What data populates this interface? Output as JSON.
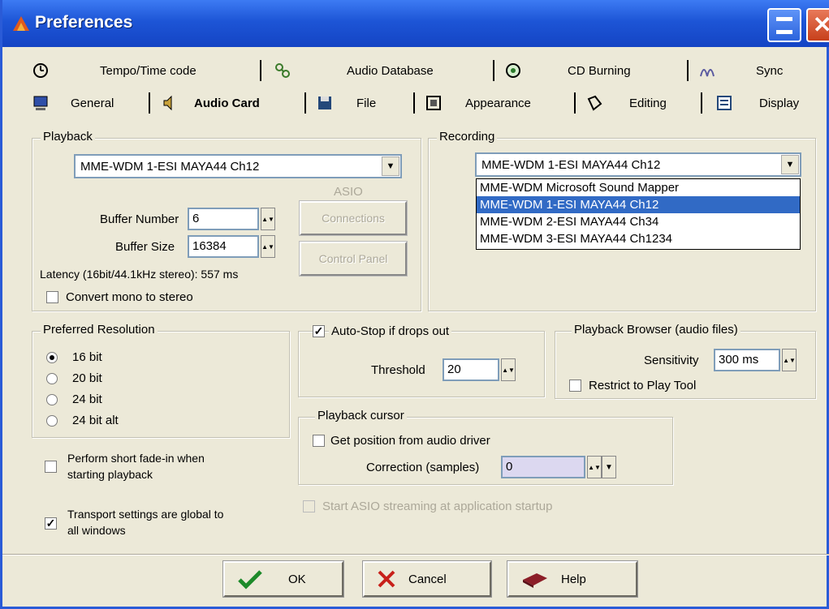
{
  "window": {
    "title": "Preferences"
  },
  "tabs_row1": [
    {
      "label": "Tempo/Time code",
      "icon": "clock-icon"
    },
    {
      "label": "Audio Database",
      "icon": "database-icon"
    },
    {
      "label": "CD Burning",
      "icon": "cd-icon"
    },
    {
      "label": "Sync",
      "icon": "sync-icon"
    }
  ],
  "tabs_row2": [
    {
      "label": "General",
      "icon": "computer-icon"
    },
    {
      "label": "Audio Card",
      "icon": "speaker-icon",
      "active": true
    },
    {
      "label": "File",
      "icon": "floppy-icon"
    },
    {
      "label": "Appearance",
      "icon": "appearance-icon"
    },
    {
      "label": "Editing",
      "icon": "editing-icon"
    },
    {
      "label": "Display",
      "icon": "display-icon"
    }
  ],
  "playback": {
    "label": "Playback",
    "device": "MME-WDM 1-ESI MAYA44 Ch12",
    "asio_label": "ASIO",
    "buffer_number_label": "Buffer Number",
    "buffer_number": "6",
    "buffer_size_label": "Buffer Size",
    "buffer_size": "16384",
    "connections_button": "Connections",
    "control_panel_button": "Control Panel",
    "latency": "Latency (16bit/44.1kHz stereo): 557 ms",
    "convert_mono_label": "Convert mono to stereo",
    "convert_mono_checked": false
  },
  "recording": {
    "label": "Recording",
    "device": "MME-WDM 1-ESI MAYA44 Ch12",
    "options": [
      "MME-WDM Microsoft Sound Mapper",
      "MME-WDM 1-ESI MAYA44 Ch12",
      "MME-WDM 2-ESI MAYA44 Ch34",
      "MME-WDM 3-ESI MAYA44 Ch1234"
    ],
    "selected_index": 1
  },
  "preferred_resolution": {
    "label": "Preferred Resolution",
    "options": [
      "16 bit",
      "20 bit",
      "24 bit",
      "24 bit alt"
    ],
    "selected_index": 0
  },
  "autostop": {
    "label": "Auto-Stop if drops out",
    "checked": true,
    "threshold_label": "Threshold",
    "threshold": "20"
  },
  "playback_browser": {
    "label": "Playback Browser (audio files)",
    "sensitivity_label": "Sensitivity",
    "sensitivity": "300 ms",
    "restrict_label": "Restrict to Play Tool",
    "restrict_checked": false
  },
  "playback_cursor": {
    "label": "Playback cursor",
    "get_position_label": "Get position from audio driver",
    "get_position_checked": false,
    "correction_label": "Correction (samples)",
    "correction": "0"
  },
  "misc": {
    "fade_line1": "Perform short fade-in when",
    "fade_line2": "starting playback",
    "transport_line1": "Transport settings are global to",
    "transport_line2": "all windows",
    "transport_checked": true,
    "asio_startup_label": "Start ASIO streaming at application startup"
  },
  "buttons": {
    "ok": "OK",
    "cancel": "Cancel",
    "help": "Help"
  },
  "colors": {
    "titlebar": "#1d55d6",
    "selection": "#316ac5",
    "face": "#ece9d8"
  }
}
